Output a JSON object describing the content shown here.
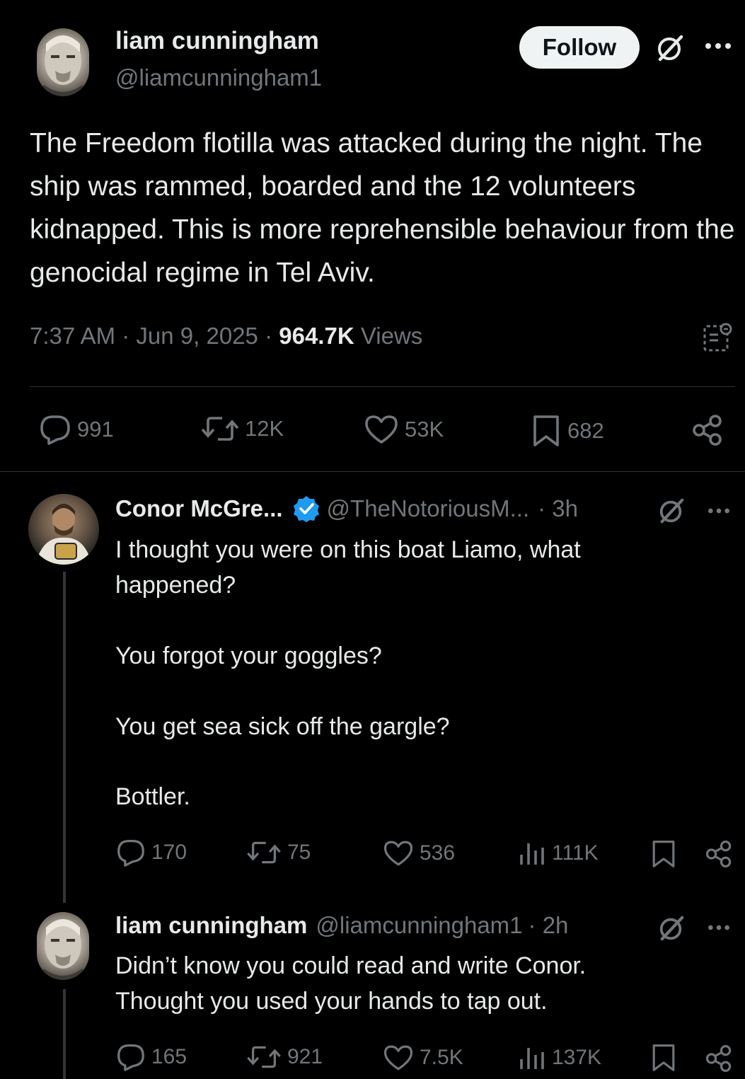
{
  "main_tweet": {
    "author_name": "liam cunningham",
    "author_handle": "@liamcunningham1",
    "follow_label": "Follow",
    "text": "The Freedom flotilla was attacked during the night. The ship was rammed, boarded and the 12 volunteers kidnapped. This is more reprehensible behaviour from the genocidal regime in Tel Aviv.",
    "time": "7:37 AM",
    "date": "Jun 9, 2025",
    "views_count": "964.7K",
    "views_label": "Views",
    "replies": "991",
    "reposts": "12K",
    "likes": "53K",
    "bookmarks": "682"
  },
  "replies": [
    {
      "author_name": "Conor McGre...",
      "author_handle": "@TheNotoriousM...",
      "time": "· 3h",
      "verified": true,
      "lines": [
        "I thought you were on this boat Liamo, what happened?",
        "You forgot your goggles?",
        "You get sea sick off the gargle?",
        "Bottler."
      ],
      "replies": "170",
      "reposts": "75",
      "likes": "536",
      "views": "111K"
    },
    {
      "author_name": "liam cunningham",
      "author_handle": "@liamcunningham1",
      "time": "· 2h",
      "verified": false,
      "lines": [
        "Didn’t know you could read and write Conor. Thought you used your hands to tap out."
      ],
      "replies": "165",
      "reposts": "921",
      "likes": "7.5K",
      "views": "137K"
    }
  ],
  "icons": {
    "grok": "grok-icon",
    "more": "more-icon",
    "reply": "reply-icon",
    "repost": "repost-icon",
    "like": "heart-icon",
    "bookmark": "bookmark-icon",
    "share": "share-icon",
    "views": "views-icon",
    "community_notes": "community-notes-icon",
    "verified": "verified-badge-icon"
  },
  "colors": {
    "background": "#000000",
    "text": "#e7e9ea",
    "muted": "#71767b",
    "divider": "#2f3336",
    "verified": "#1d9bf0",
    "follow_bg": "#eff3f4"
  }
}
